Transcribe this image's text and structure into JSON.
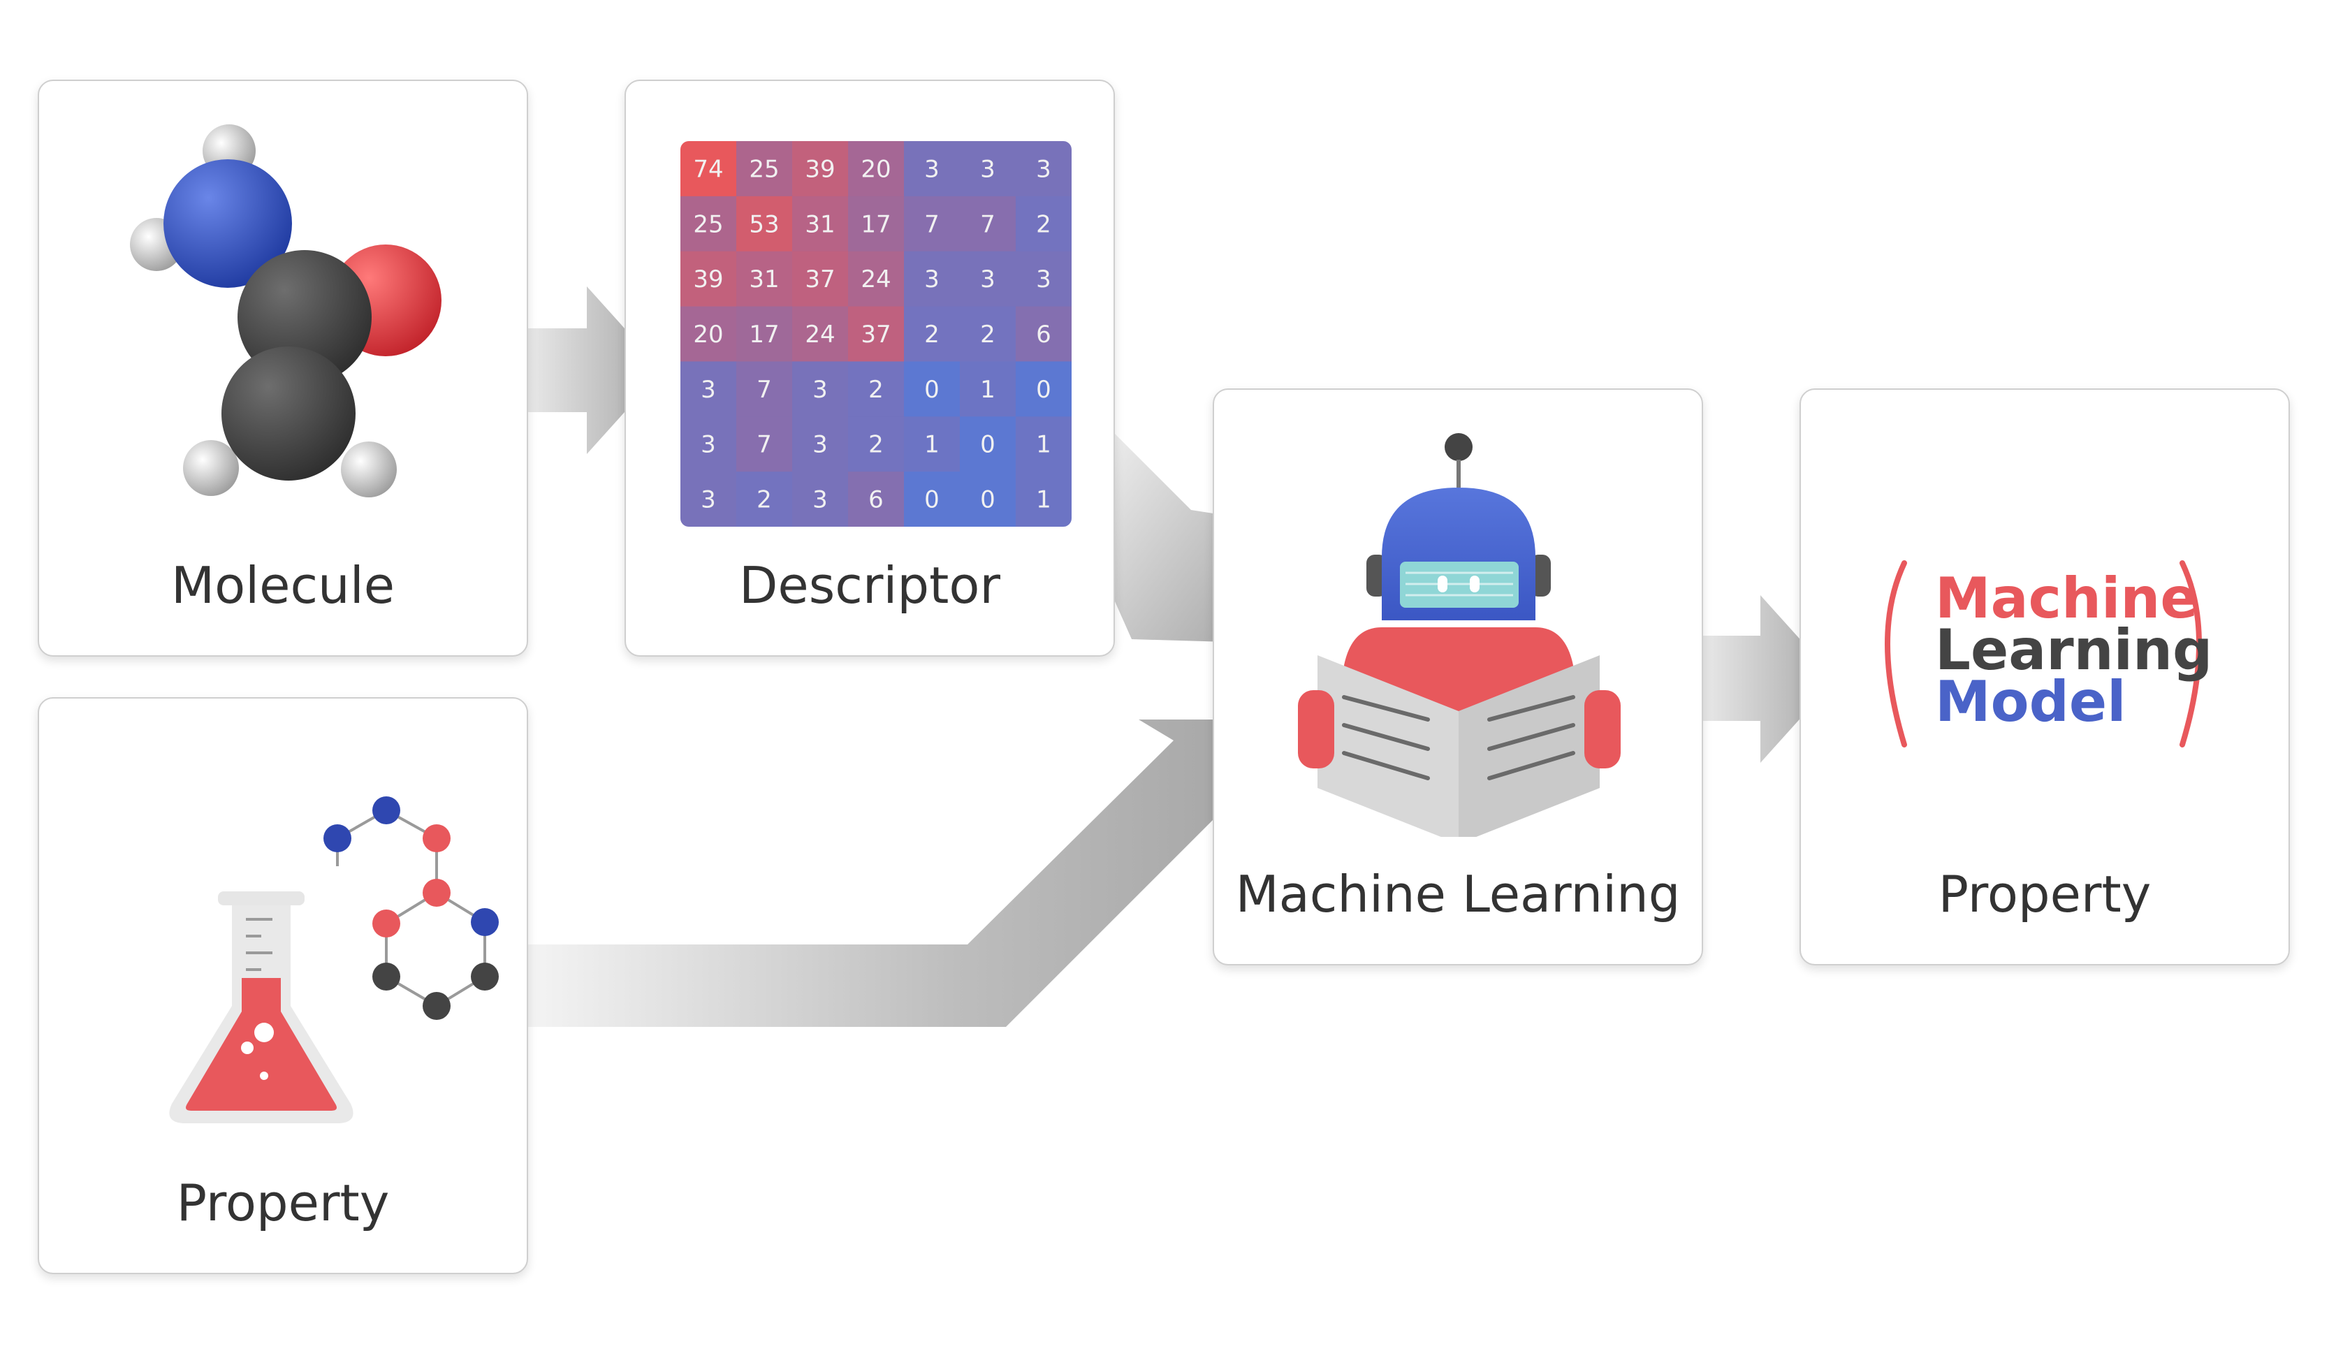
{
  "cards": {
    "molecule": {
      "label": "Molecule"
    },
    "descriptor": {
      "label": "Descriptor"
    },
    "property_input": {
      "label": "Property"
    },
    "machine_learning": {
      "label": "Machine Learning"
    },
    "property_output": {
      "label": "Property"
    }
  },
  "descriptor_matrix": [
    [
      74,
      25,
      39,
      20,
      3,
      3,
      3
    ],
    [
      25,
      53,
      31,
      17,
      7,
      7,
      2
    ],
    [
      39,
      31,
      37,
      24,
      3,
      3,
      3
    ],
    [
      20,
      17,
      24,
      37,
      2,
      2,
      6
    ],
    [
      3,
      7,
      3,
      2,
      0,
      1,
      0
    ],
    [
      3,
      7,
      3,
      2,
      1,
      0,
      1
    ],
    [
      3,
      2,
      3,
      6,
      0,
      0,
      1
    ]
  ],
  "model_text": {
    "line1": "Machine",
    "line2": "Learning",
    "line3": "Model"
  },
  "colors": {
    "red": "#e8585c",
    "blue": "#4a63c8",
    "dark": "#444444",
    "arrow": "#a9a9a9"
  },
  "icons": [
    "molecule-icon",
    "descriptor-matrix",
    "flask-icon",
    "robot-reading-icon",
    "model-bracket-icon"
  ]
}
